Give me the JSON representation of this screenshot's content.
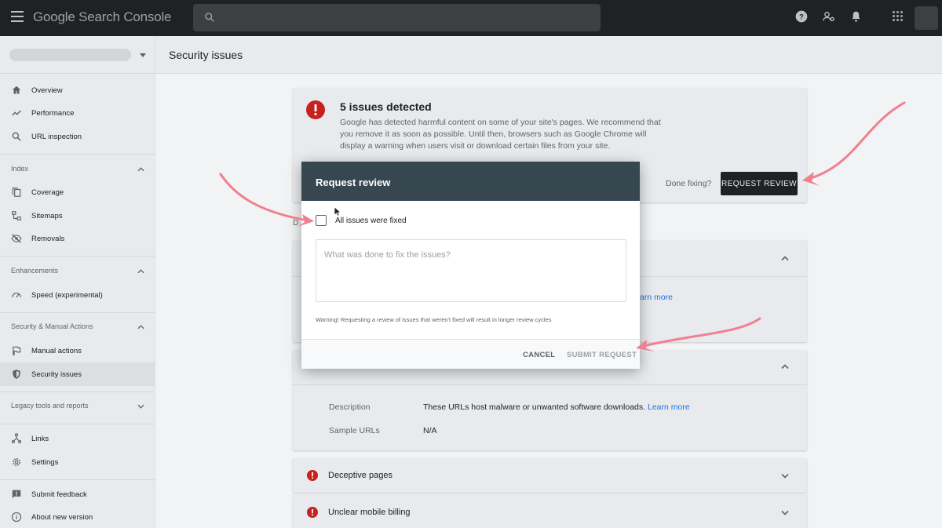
{
  "app": {
    "title": "Google Search Console"
  },
  "colors": {
    "accent_red": "#c5221f",
    "annotation_arrow": "#f08090",
    "link": "#1a73e8"
  },
  "sidebar": {
    "items_top": [
      {
        "label": "Overview",
        "icon": "home-icon"
      },
      {
        "label": "Performance",
        "icon": "trending-up-icon"
      },
      {
        "label": "URL inspection",
        "icon": "search-icon"
      }
    ],
    "sections": {
      "index": "Index",
      "enhancements": "Enhancements",
      "security": "Security & Manual Actions",
      "legacy": "Legacy tools and reports"
    },
    "index_items": [
      {
        "label": "Coverage",
        "icon": "file-copy-icon"
      },
      {
        "label": "Sitemaps",
        "icon": "sitemap-icon"
      },
      {
        "label": "Removals",
        "icon": "visibility-off-icon"
      }
    ],
    "enh_items": [
      {
        "label": "Speed (experimental)",
        "icon": "speed-gauge-icon"
      }
    ],
    "sec_items": [
      {
        "label": "Manual actions",
        "icon": "flag-icon"
      },
      {
        "label": "Security issues",
        "icon": "shield-icon"
      }
    ],
    "bottom_items": [
      {
        "label": "Links",
        "icon": "links-icon"
      },
      {
        "label": "Settings",
        "icon": "gear-icon"
      },
      {
        "label": "Submit feedback",
        "icon": "feedback-icon"
      },
      {
        "label": "About new version",
        "icon": "info-icon"
      }
    ]
  },
  "page": {
    "title": "Security issues"
  },
  "summary": {
    "title": "5 issues detected",
    "text": "Google has detected harmful content on some of your site's pages. We recommend that you remove it as soon as possible. Until then, browsers such as Google Chrome will display a warning when users visit or download certain files from your site.",
    "done_label": "Done fixing?",
    "request_btn": "REQUEST REVIEW"
  },
  "partial": {
    "d_letter": "D",
    "learn_more_fragment": "arn more"
  },
  "malware": {
    "desc_key": "Description",
    "desc_val": "These URLs host malware or unwanted software downloads.",
    "learn_more": "Learn more",
    "sample_key": "Sample URLs",
    "sample_val": "N/A"
  },
  "issues": [
    {
      "title": "Deceptive pages"
    },
    {
      "title": "Unclear mobile billing"
    }
  ],
  "dialog": {
    "title": "Request review",
    "checkbox_label": "All issues were fixed",
    "textarea_placeholder": "What was done to fix the issues?",
    "warning": "Warning! Requesting a review of issues that weren't fixed will result in longer review cycles",
    "cancel": "CANCEL",
    "submit": "SUBMIT REQUEST"
  }
}
